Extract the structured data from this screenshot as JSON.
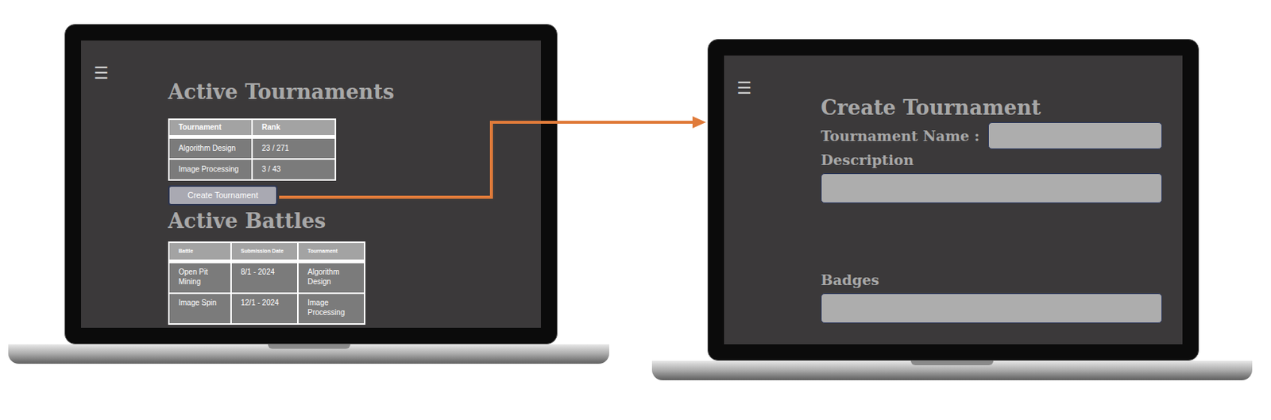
{
  "tournaments_screen": {
    "menu_icon": "☰",
    "title": "Active Tournaments",
    "tournaments_table": {
      "columns": [
        "Tournament",
        "Rank"
      ],
      "rows": [
        [
          "Algorithm Design",
          "23 / 271"
        ],
        [
          "Image Processing",
          "3 / 43"
        ]
      ]
    },
    "create_button": "Create Tournament",
    "battles_title": "Active Battles",
    "battles_table": {
      "columns": [
        "Battle",
        "Submission Date",
        "Tournament"
      ],
      "rows": [
        [
          "Open Pit Mining",
          "8/1 - 2024",
          "Algorithm Design"
        ],
        [
          "Image Spin",
          "12/1 - 2024",
          "Image Processing"
        ]
      ]
    }
  },
  "create_screen": {
    "menu_icon": "☰",
    "title": "Create Tournament",
    "fields": [
      {
        "label": "Tournament Name :",
        "kind": "inline"
      },
      {
        "label": "Description",
        "kind": "stacked"
      },
      {
        "label": "Badges",
        "kind": "stacked"
      }
    ]
  }
}
